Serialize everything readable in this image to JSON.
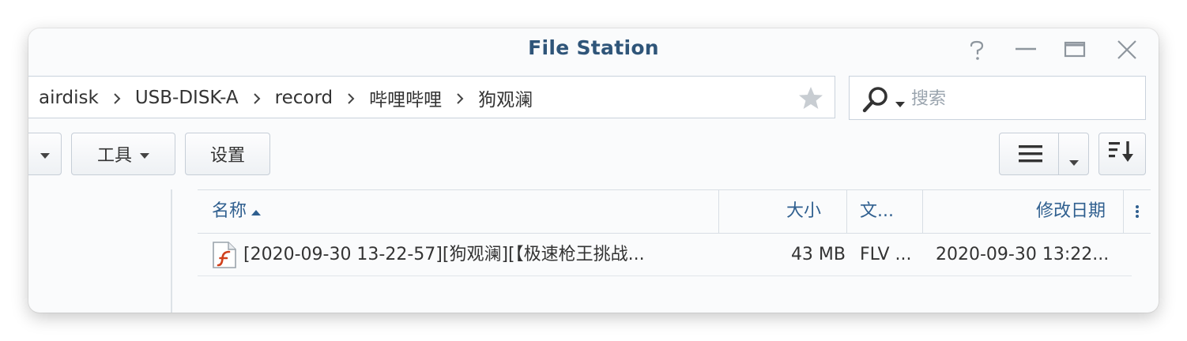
{
  "window": {
    "title": "File Station"
  },
  "breadcrumb": [
    "airdisk",
    "USB-DISK-A",
    "record",
    "哔哩哔哩",
    "狗观澜"
  ],
  "search": {
    "placeholder": "搜索",
    "value": ""
  },
  "toolbar": {
    "tools_label": "工具",
    "settings_label": "设置"
  },
  "columns": {
    "name": "名称",
    "size": "大小",
    "type": "文...",
    "modified": "修改日期"
  },
  "rows": [
    {
      "name": "[2020-09-30 13-22-57][狗观澜][【极速枪王挑战...",
      "size": "43 MB",
      "type": "FLV ...",
      "modified": "2020-09-30 13:22..."
    }
  ],
  "colors": {
    "title": "#2f5579",
    "header_text": "#2f5f8f",
    "border": "#c9d2dc",
    "file_icon_accent": "#d0401c"
  }
}
